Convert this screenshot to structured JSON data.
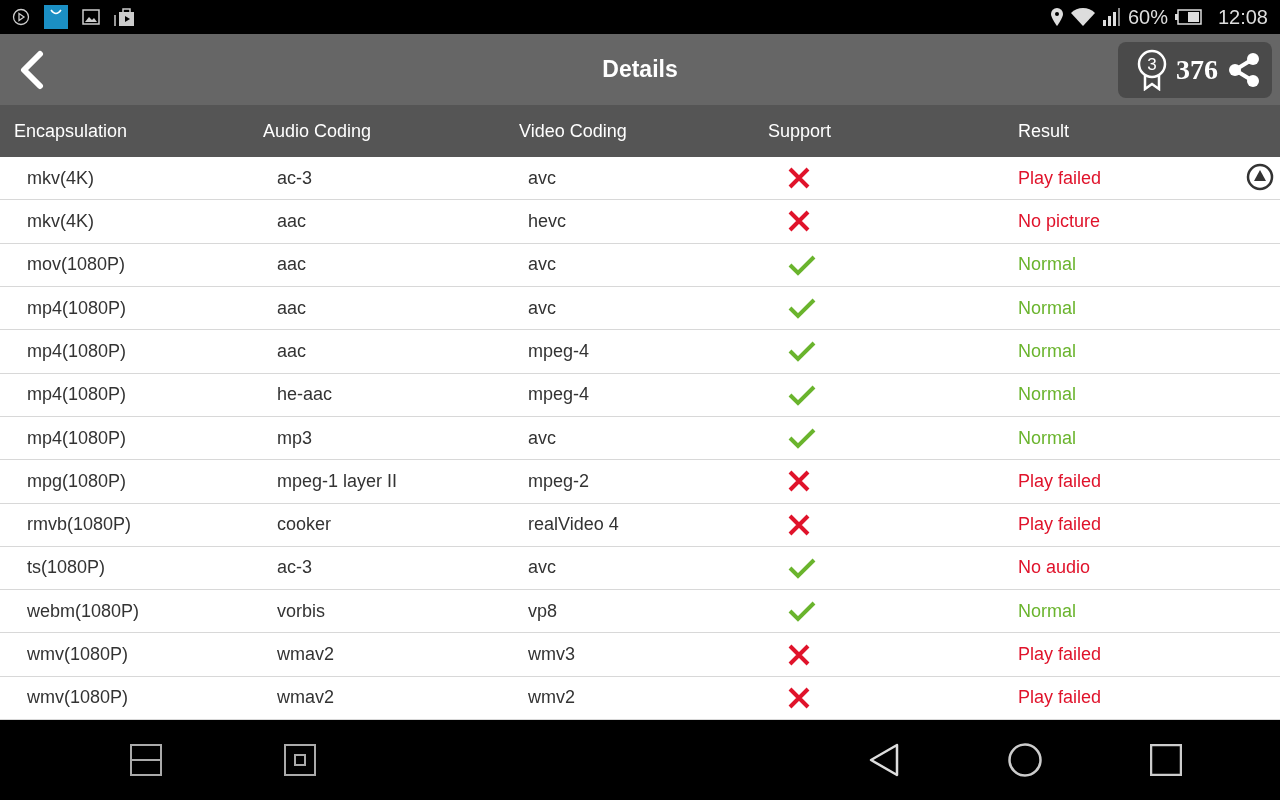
{
  "status_bar": {
    "battery": "60%",
    "time": "12:08"
  },
  "header": {
    "title": "Details",
    "rank": "3",
    "score": "376"
  },
  "table": {
    "columns": [
      "Encapsulation",
      "Audio Coding",
      "Video Coding",
      "Support",
      "Result"
    ],
    "rows": [
      {
        "encapsulation": "mkv(4K)",
        "audio": "ac-3",
        "video": "avc",
        "supported": false,
        "result": "Play failed",
        "result_ok": false
      },
      {
        "encapsulation": "mkv(4K)",
        "audio": "aac",
        "video": "hevc",
        "supported": false,
        "result": "No picture",
        "result_ok": false
      },
      {
        "encapsulation": "mov(1080P)",
        "audio": "aac",
        "video": "avc",
        "supported": true,
        "result": "Normal",
        "result_ok": true
      },
      {
        "encapsulation": "mp4(1080P)",
        "audio": "aac",
        "video": "avc",
        "supported": true,
        "result": "Normal",
        "result_ok": true
      },
      {
        "encapsulation": "mp4(1080P)",
        "audio": "aac",
        "video": "mpeg-4",
        "supported": true,
        "result": "Normal",
        "result_ok": true
      },
      {
        "encapsulation": "mp4(1080P)",
        "audio": "he-aac",
        "video": "mpeg-4",
        "supported": true,
        "result": "Normal",
        "result_ok": true
      },
      {
        "encapsulation": "mp4(1080P)",
        "audio": "mp3",
        "video": "avc",
        "supported": true,
        "result": "Normal",
        "result_ok": true
      },
      {
        "encapsulation": "mpg(1080P)",
        "audio": "mpeg-1 layer II",
        "video": "mpeg-2",
        "supported": false,
        "result": "Play failed",
        "result_ok": false
      },
      {
        "encapsulation": "rmvb(1080P)",
        "audio": "cooker",
        "video": "realVideo 4",
        "supported": false,
        "result": "Play failed",
        "result_ok": false
      },
      {
        "encapsulation": "ts(1080P)",
        "audio": "ac-3",
        "video": "avc",
        "supported": true,
        "result": "No audio",
        "result_ok": false
      },
      {
        "encapsulation": "webm(1080P)",
        "audio": "vorbis",
        "video": "vp8",
        "supported": true,
        "result": "Normal",
        "result_ok": true
      },
      {
        "encapsulation": "wmv(1080P)",
        "audio": "wmav2",
        "video": "wmv3",
        "supported": false,
        "result": "Play failed",
        "result_ok": false
      },
      {
        "encapsulation": "wmv(1080P)",
        "audio": "wmav2",
        "video": "wmv2",
        "supported": false,
        "result": "Play failed",
        "result_ok": false
      }
    ]
  }
}
